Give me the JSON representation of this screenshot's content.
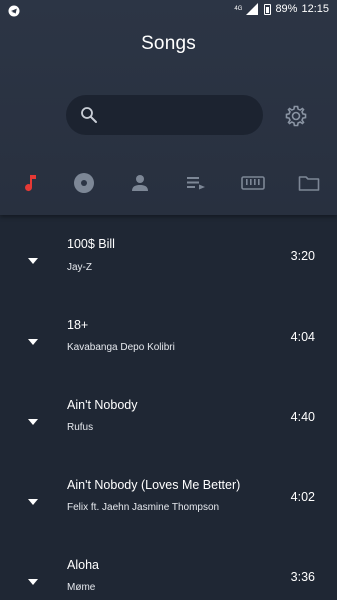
{
  "status_bar": {
    "network": "4G",
    "battery": "89%",
    "time": "12:15"
  },
  "header": {
    "title": "Songs"
  },
  "search": {
    "placeholder": "",
    "value": ""
  },
  "tabs": [
    {
      "name": "songs",
      "icon": "music-note-icon",
      "active": true
    },
    {
      "name": "albums",
      "icon": "disc-icon",
      "active": false
    },
    {
      "name": "artists",
      "icon": "person-icon",
      "active": false
    },
    {
      "name": "playlists",
      "icon": "playlist-icon",
      "active": false
    },
    {
      "name": "genres",
      "icon": "piano-keys-icon",
      "active": false
    },
    {
      "name": "folders",
      "icon": "folder-icon",
      "active": false
    }
  ],
  "colors": {
    "active_tab": "#e53935",
    "inactive_tab": "#7d8796",
    "header_bg": "#2c3545",
    "list_bg": "#1f2734"
  },
  "songs": [
    {
      "title": "100$ Bill",
      "artist": "Jay-Z",
      "duration": "3:20"
    },
    {
      "title": "18+",
      "artist": "Kavabanga Depo Kolibri",
      "duration": "4:04"
    },
    {
      "title": "Ain't Nobody",
      "artist": "Rufus",
      "duration": "4:40"
    },
    {
      "title": "Ain't Nobody (Loves Me Better)",
      "artist": "Felix ft. Jaehn Jasmine Thompson",
      "duration": "4:02"
    },
    {
      "title": "Aloha",
      "artist": "Møme",
      "duration": "3:36"
    }
  ]
}
